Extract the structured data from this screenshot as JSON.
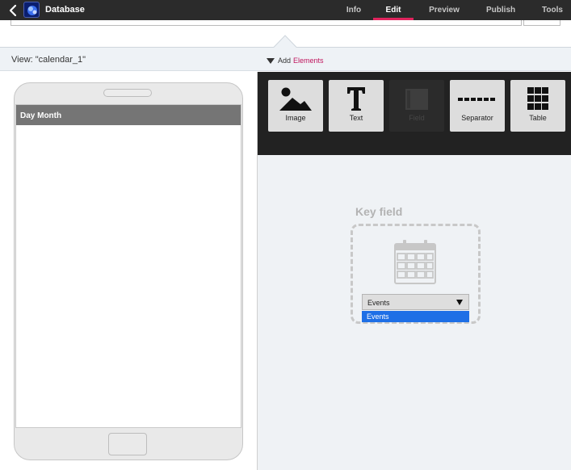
{
  "app": {
    "title": "Database"
  },
  "nav": {
    "tabs": [
      {
        "label": "Info",
        "active": false
      },
      {
        "label": "Edit",
        "active": true
      },
      {
        "label": "Preview",
        "active": false
      },
      {
        "label": "Publish",
        "active": false
      },
      {
        "label": "Tools",
        "active": false
      }
    ],
    "accent_color": "#e0245e"
  },
  "view": {
    "label": "View: \"calendar_1\""
  },
  "add_elements": {
    "prefix": "Add",
    "accent": "Elements",
    "accent_color": "#c0155d"
  },
  "phone": {
    "header": "Day Month"
  },
  "palette": {
    "items": [
      {
        "label": "Image",
        "icon": "image-icon",
        "enabled": true
      },
      {
        "label": "Text",
        "icon": "text-icon",
        "enabled": true
      },
      {
        "label": "Field",
        "icon": "field-icon",
        "enabled": false
      },
      {
        "label": "Separator",
        "icon": "separator-icon",
        "enabled": true
      },
      {
        "label": "Table",
        "icon": "table-icon",
        "enabled": true
      }
    ]
  },
  "key_field": {
    "title": "Key field",
    "select_value": "Events",
    "options": [
      "Events"
    ],
    "highlight_color": "#1e6fe6"
  }
}
